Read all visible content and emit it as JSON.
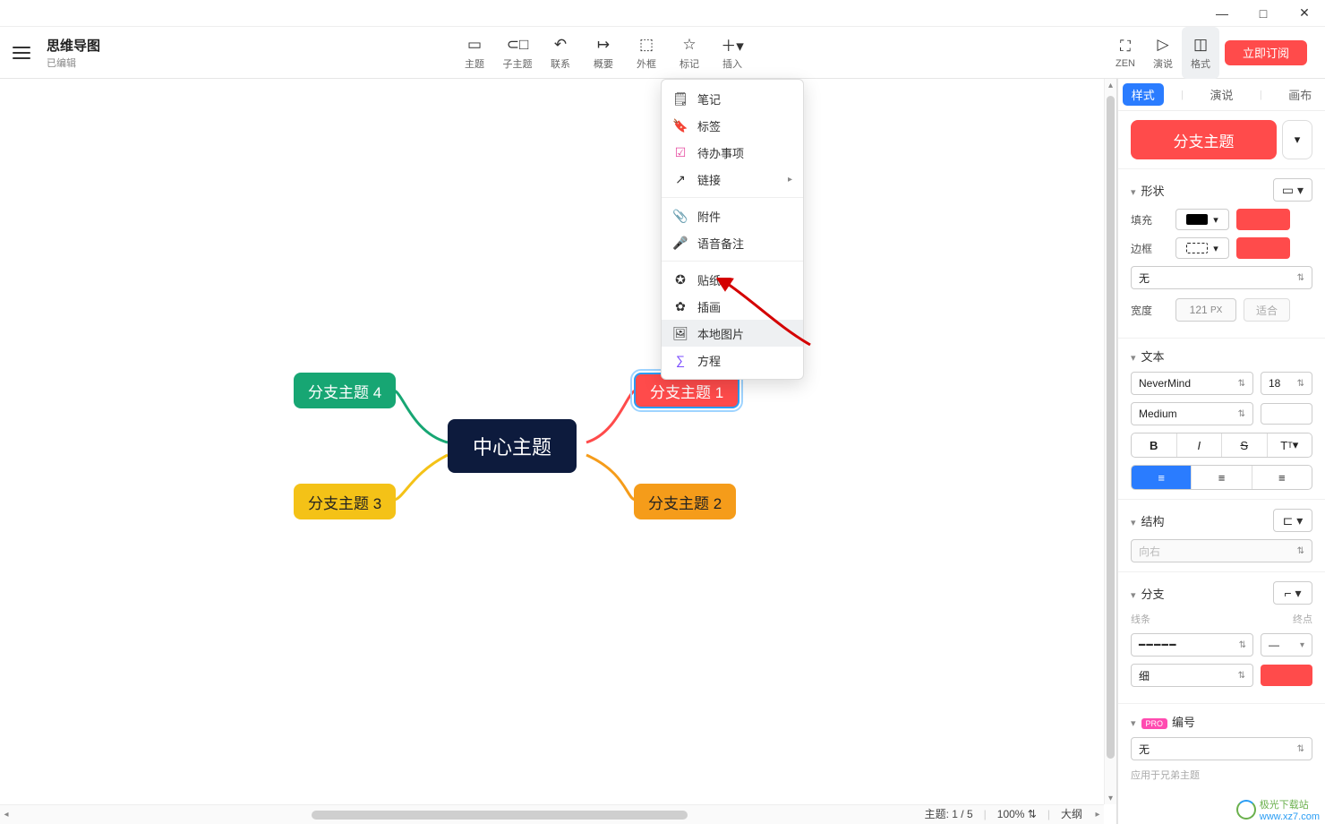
{
  "window": {
    "min": "—",
    "max": "□",
    "close": "✕"
  },
  "title": {
    "main": "思维导图",
    "sub": "已编辑"
  },
  "toolbar": {
    "theme": "主题",
    "subtheme": "子主题",
    "relation": "联系",
    "summary": "概要",
    "boundary": "外框",
    "marker": "标记",
    "insert": "插入",
    "zen": "ZEN",
    "present": "演说",
    "format": "格式",
    "subscribe": "立即订阅"
  },
  "menu": {
    "notes": "笔记",
    "label": "标签",
    "todo": "待办事项",
    "link": "链接",
    "attachment": "附件",
    "audio": "语音备注",
    "sticker": "贴纸",
    "illustration": "插画",
    "localimg": "本地图片",
    "equation": "方程"
  },
  "nodes": {
    "center": "中心主题",
    "b1": "分支主题 1",
    "b2": "分支主题 2",
    "b3": "分支主题 3",
    "b4": "分支主题 4"
  },
  "panel": {
    "tabs": {
      "style": "样式",
      "present": "演说",
      "canvas": "画布"
    },
    "branch_btn": "分支主题",
    "shape": "形状",
    "fill": "填充",
    "border": "边框",
    "border_style_none": "无",
    "width": "宽度",
    "width_val": "121",
    "width_unit": "PX",
    "fit": "适合",
    "text": "文本",
    "font_name": "NeverMind",
    "font_size": "18",
    "font_weight": "Medium",
    "bold": "B",
    "italic": "I",
    "strike": "S",
    "textcolor": "T",
    "case": "T",
    "structure": "结构",
    "direction": "向右",
    "branch": "分支",
    "line": "线条",
    "endpoint": "终点",
    "thin": "细",
    "numbering": "编号",
    "num_none": "无",
    "pro": "PRO",
    "apply": "应用于兄弟主题"
  },
  "status": {
    "topics": "主题: 1 / 5",
    "zoom": "100%",
    "outline": "大纲"
  },
  "colors": {
    "fill": "#000000",
    "fillbox": "#ff4b4b",
    "borderbox": "#ff4b4b",
    "branchcolor": "#ff4b4b"
  },
  "watermark": {
    "site": "极光下载站",
    "url": "www.xz7.com"
  }
}
